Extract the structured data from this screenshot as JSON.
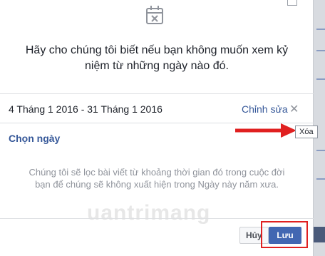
{
  "dialog": {
    "intro_text": "Hãy cho chúng tôi biết nếu bạn không muốn xem kỷ niệm từ những ngày nào đó.",
    "date_range": "4 Tháng 1 2016 - 31 Tháng 1 2016",
    "edit_label": "Chỉnh sửa",
    "remove_symbol": "✕",
    "choose_date_label": "Chọn ngày",
    "description": "Chúng tôi sẽ lọc bài viết từ khoảng thời gian đó trong cuộc đời bạn để chúng sẽ không xuất hiện trong Ngày này năm xưa.",
    "cancel_label": "Hủy",
    "save_label": "Lưu"
  },
  "tooltip": {
    "text": "Xóa"
  },
  "watermark": {
    "text": "uantrimang"
  },
  "colors": {
    "link": "#365899",
    "primary_button": "#4267b2",
    "annotation_red": "#e02020"
  }
}
